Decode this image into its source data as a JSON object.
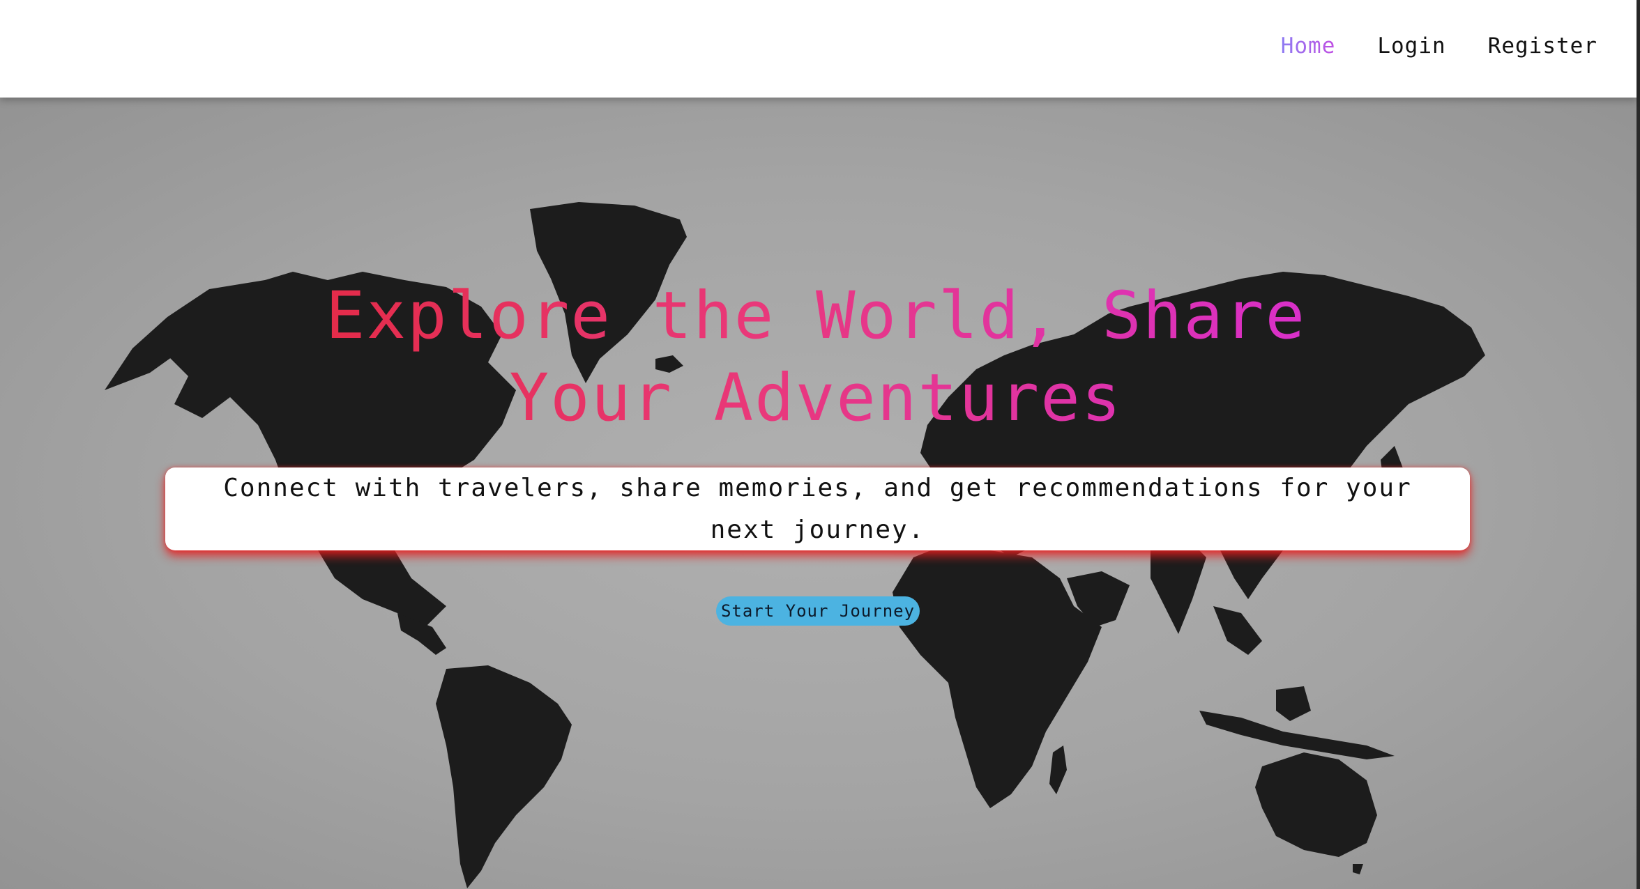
{
  "nav": {
    "links": [
      {
        "label": "Home",
        "active": true
      },
      {
        "label": "Login",
        "active": false
      },
      {
        "label": "Register",
        "active": false
      }
    ]
  },
  "hero": {
    "title": "Explore the World, Share Your Adventures",
    "subtitle": "Connect with travelers, share memories, and get recommendations for your next journey.",
    "cta_label": "Start Your Journey",
    "background": "world-map-image"
  },
  "colors": {
    "nav_active_gradient": [
      "#8e7bf2",
      "#c04fe3"
    ],
    "title_gradient": [
      "#e3293f",
      "#e9387a",
      "#d62ed8"
    ],
    "cta_background": "#4cb3e1",
    "subtitle_glow": "#e61e1e",
    "map_fill": "#1c1c1c"
  }
}
